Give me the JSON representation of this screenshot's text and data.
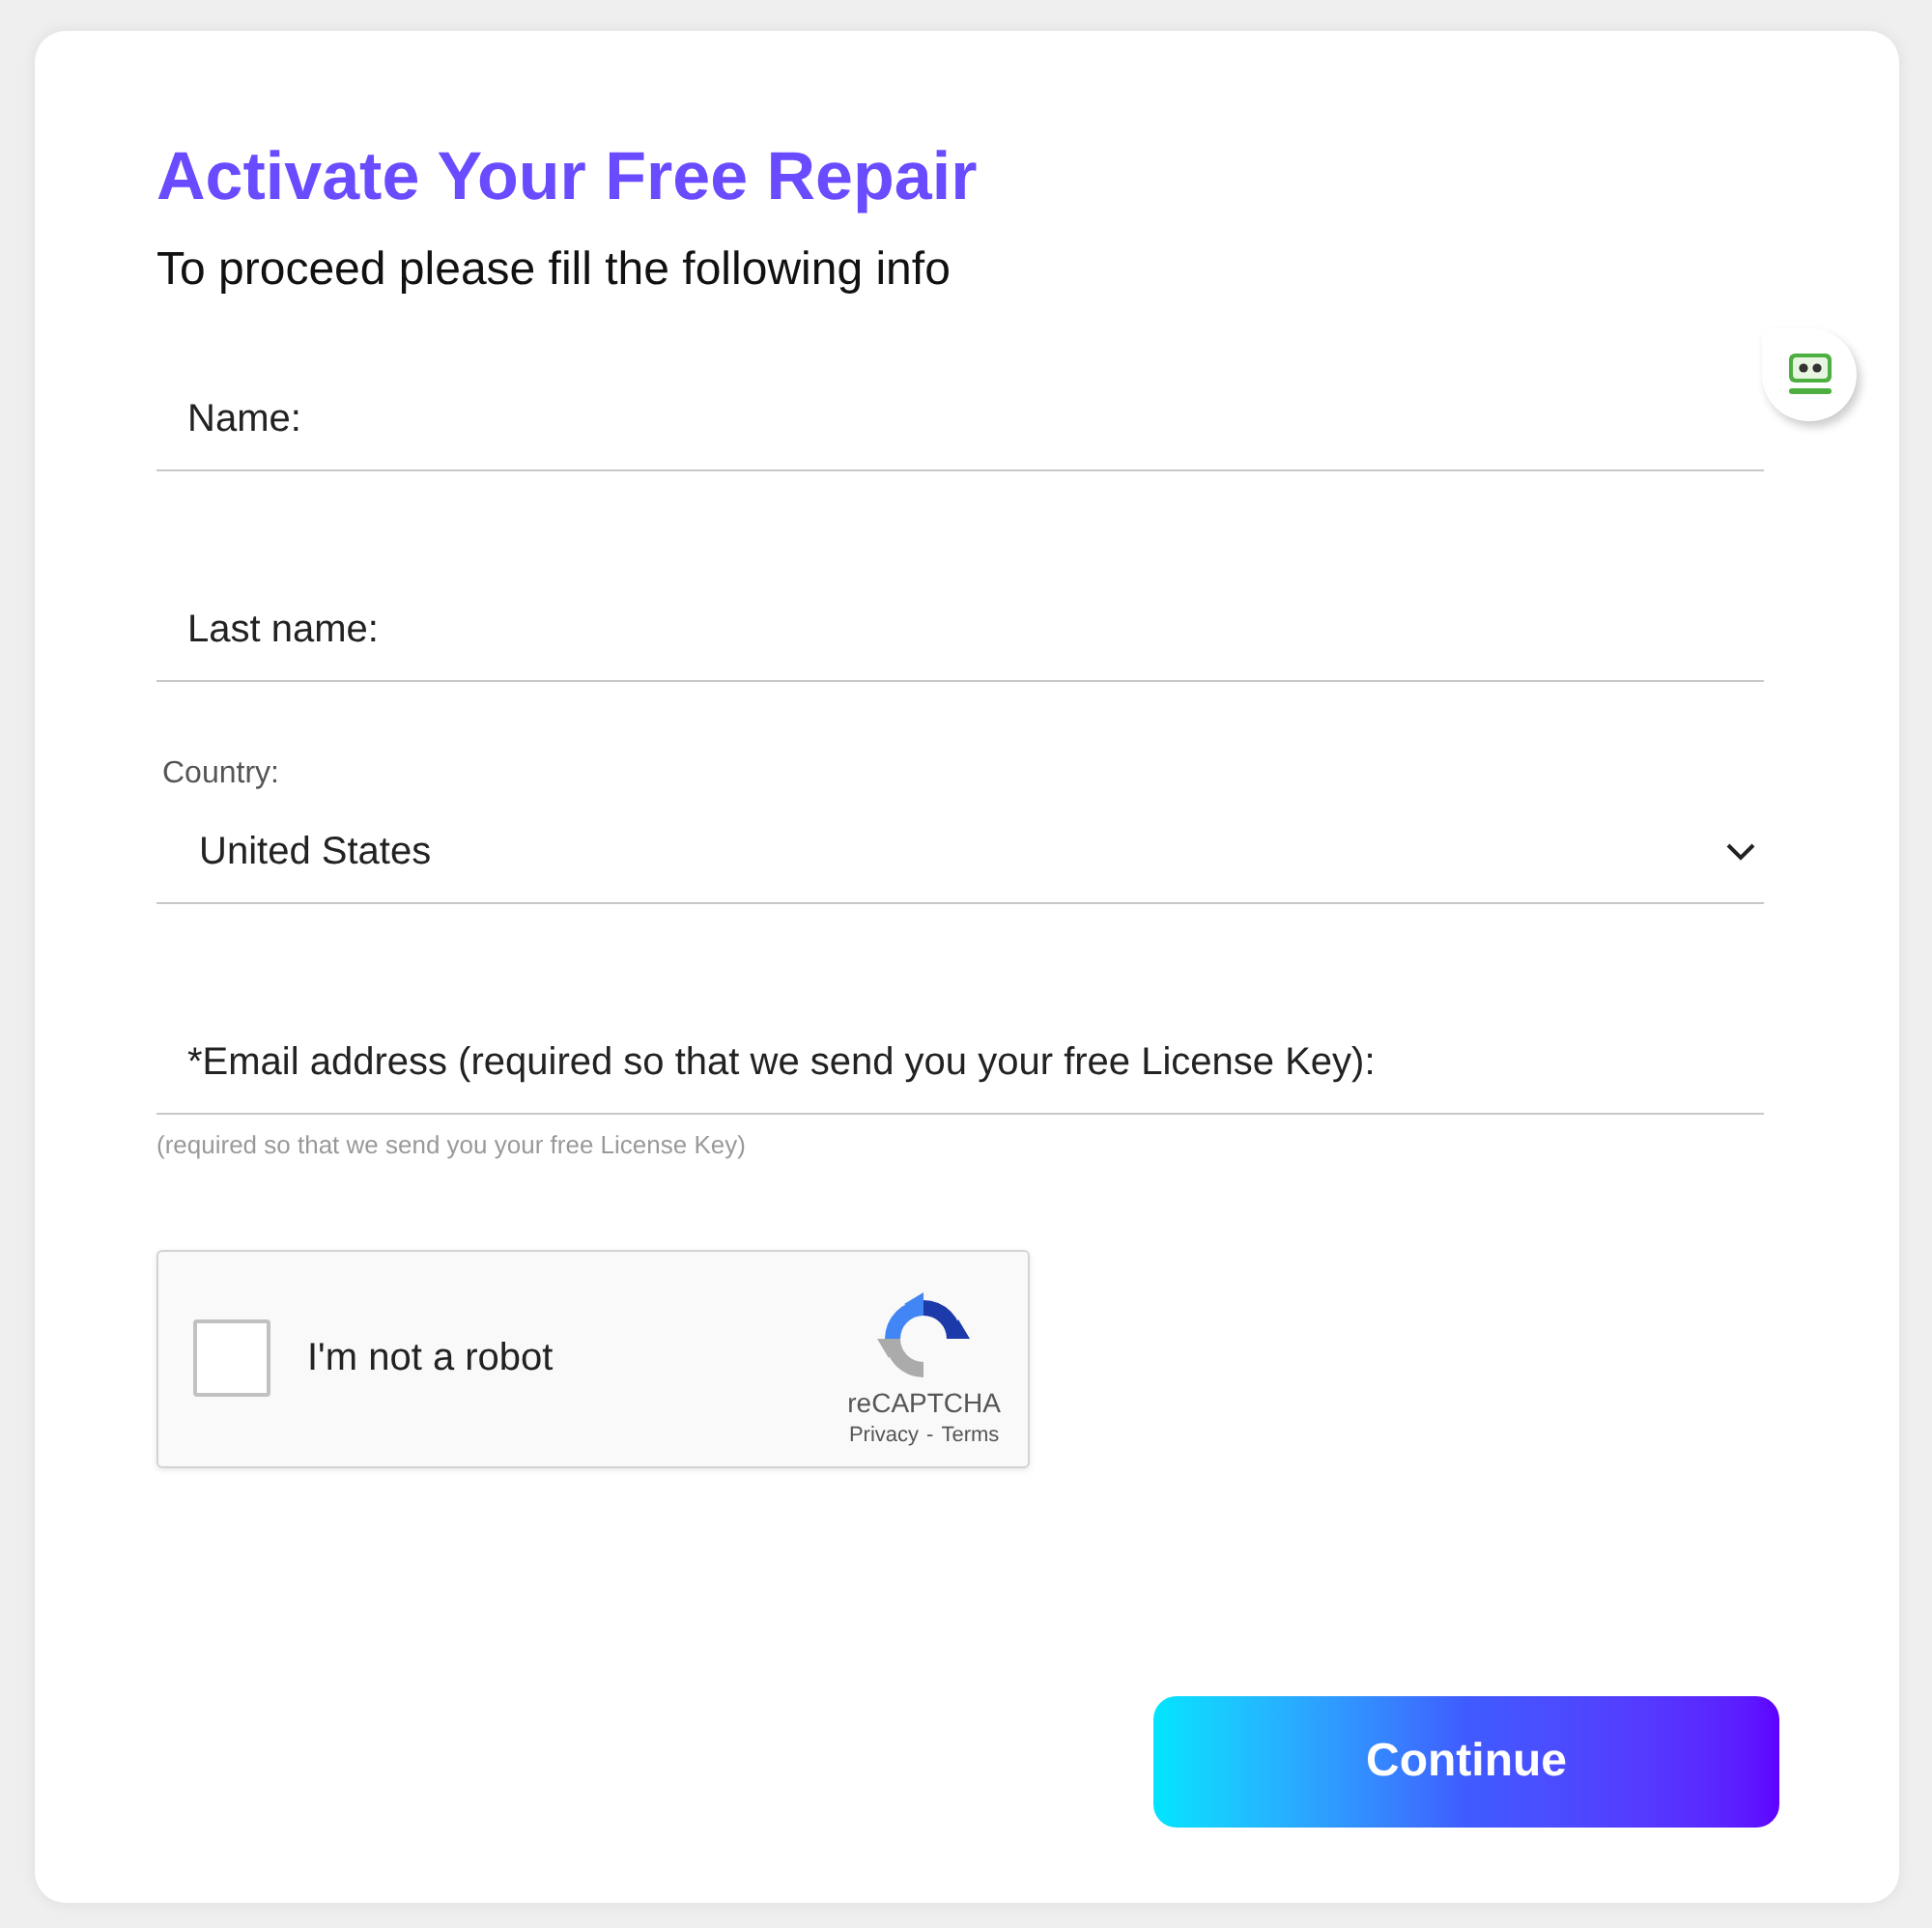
{
  "title": "Activate Your Free Repair",
  "subtitle": "To proceed please fill the following info",
  "fields": [
    {
      "kind": "text",
      "placeholder": "Name:"
    },
    {
      "kind": "text",
      "placeholder": "Last name:"
    },
    {
      "kind": "select",
      "label": "Country:",
      "value": "United States"
    },
    {
      "kind": "text",
      "placeholder": "*Email address (required so that we send you your free License Key):",
      "hint": "(required so that we send you your free License Key)"
    }
  ],
  "captcha": {
    "label": "I'm not a robot",
    "checked": false,
    "brand": "reCAPTCHA",
    "links": [
      "Privacy",
      "Terms"
    ],
    "separator": "-"
  },
  "button": "Continue"
}
